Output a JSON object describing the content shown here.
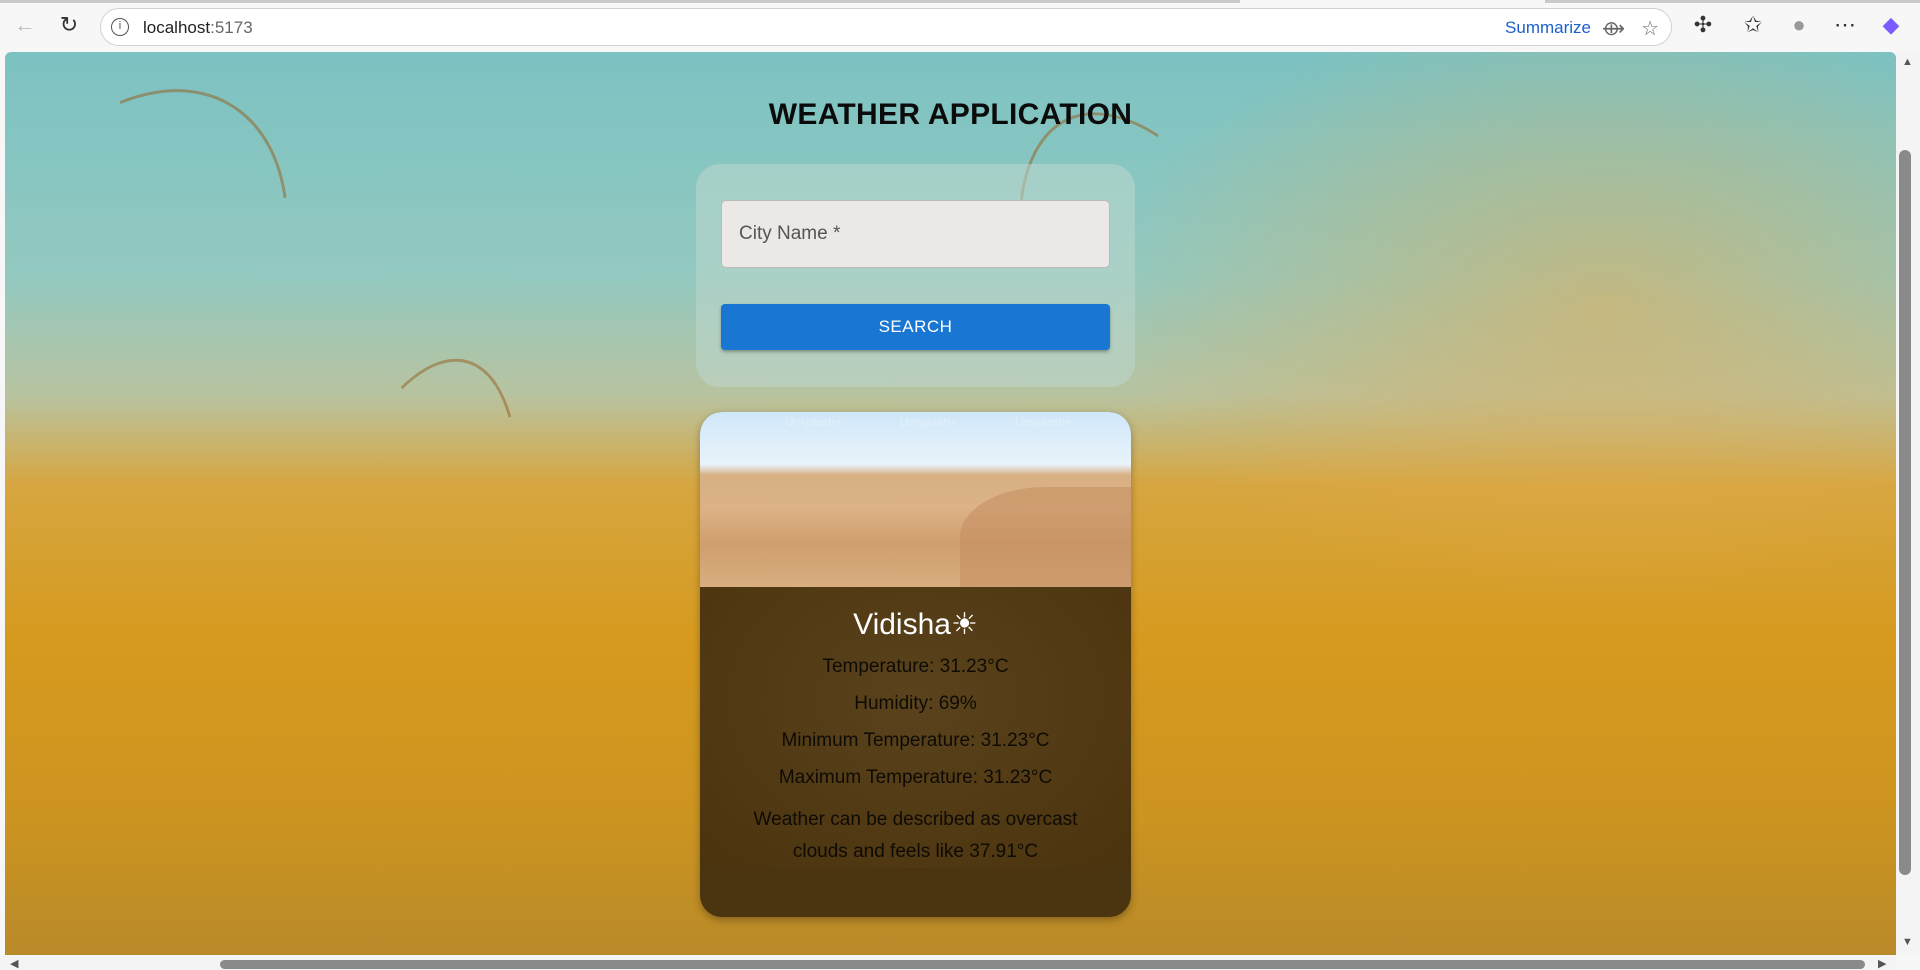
{
  "browser": {
    "url_host": "localhost",
    "url_port": ":5173",
    "summarize_label": "Summarize"
  },
  "app": {
    "title": "WEATHER APPLICATION",
    "city_placeholder": "City Name *",
    "search_label": "SEARCH"
  },
  "weather": {
    "image_watermark": "Unsplash+",
    "city": "Vidisha",
    "icon": "☀",
    "temperature": "Temperature: 31.23°C",
    "humidity": "Humidity: 69%",
    "min_temp": "Minimum Temperature: 31.23°C",
    "max_temp": "Maximum Temperature: 31.23°C",
    "description": "Weather can be described as overcast clouds and feels like 37.91°C"
  }
}
